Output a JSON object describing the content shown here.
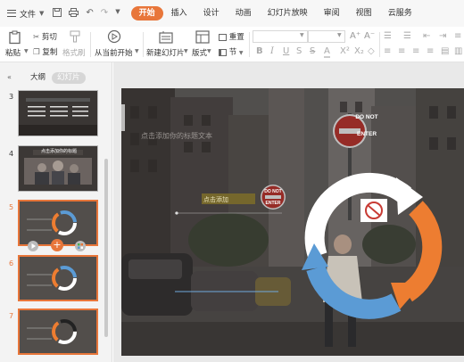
{
  "menu": {
    "file_label": "文件",
    "tabs": [
      "开始",
      "插入",
      "设计",
      "动画",
      "幻灯片放映",
      "审阅",
      "视图",
      "云服务"
    ],
    "active_tab": "开始"
  },
  "ribbon": {
    "paste": "粘贴",
    "cut": "剪切",
    "copy": "复制",
    "format_painter": "格式刷",
    "from_current": "从当前开始",
    "new_slide": "新建幻灯片",
    "layout": "版式",
    "section": "节",
    "reset": "重置"
  },
  "left_panel": {
    "tab_outline": "大纲",
    "tab_slides": "幻灯片",
    "slides": [
      {
        "number": "3"
      },
      {
        "number": "4",
        "title": "点击添加你的标题"
      },
      {
        "number": "5"
      },
      {
        "number": "6"
      },
      {
        "number": "7"
      }
    ]
  },
  "slide": {
    "placeholder_text": "点击添加你的标题文本",
    "sign_do_not_enter_top": "DO NOT",
    "sign_do_not_enter_bottom": "ENTER",
    "subtitle_text": "点击添加"
  },
  "colors": {
    "accent": "#e8763a",
    "ring_blue": "#5b9bd5",
    "ring_orange": "#ed7d31",
    "ring_white": "#ffffff"
  }
}
